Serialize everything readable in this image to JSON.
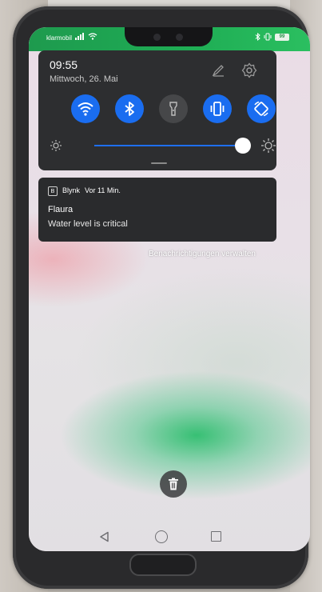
{
  "status_bar": {
    "carrier": "klarmobil",
    "battery": "99"
  },
  "quick_settings": {
    "time": "09:55",
    "date": "Mittwoch, 26. Mai",
    "tiles": [
      {
        "icon": "wifi-icon",
        "active": true
      },
      {
        "icon": "bluetooth-icon",
        "active": true
      },
      {
        "icon": "flashlight-icon",
        "active": false
      },
      {
        "icon": "vibrate-icon",
        "active": true
      },
      {
        "icon": "auto-rotate-icon",
        "active": true
      }
    ],
    "brightness_level": 0.93,
    "accent_color": "#1a6df0"
  },
  "notification": {
    "app_icon_letter": "B",
    "app_name": "Blynk",
    "time": "Vor 11 Min.",
    "title": "Flaura",
    "text": "Water level is critical"
  },
  "manage_notifications_label": "Benachrichtigungen verwalten",
  "colors": {
    "status_green": "#1fae55",
    "panel_dark": "#2d2e30"
  }
}
